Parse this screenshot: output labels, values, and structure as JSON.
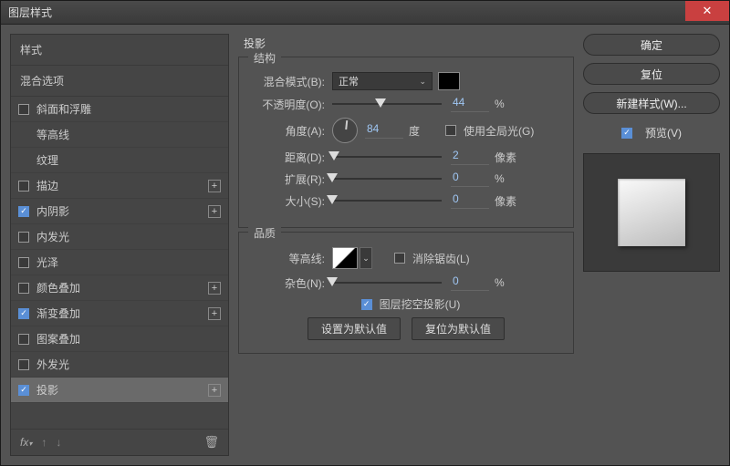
{
  "window": {
    "title": "图层样式"
  },
  "sidebar": {
    "header_styles": "样式",
    "header_blending": "混合选项",
    "items": [
      {
        "label": "斜面和浮雕",
        "checked": false
      },
      {
        "label": "等高线",
        "checked": false
      },
      {
        "label": "纹理",
        "checked": false
      },
      {
        "label": "描边",
        "checked": false,
        "plus": true
      },
      {
        "label": "内阴影",
        "checked": true,
        "plus": true
      },
      {
        "label": "内发光",
        "checked": false
      },
      {
        "label": "光泽",
        "checked": false
      },
      {
        "label": "颜色叠加",
        "checked": false,
        "plus": true
      },
      {
        "label": "渐变叠加",
        "checked": true,
        "plus": true
      },
      {
        "label": "图案叠加",
        "checked": false
      },
      {
        "label": "外发光",
        "checked": false
      },
      {
        "label": "投影",
        "checked": true,
        "plus": true,
        "selected": true
      }
    ]
  },
  "panel": {
    "title": "投影",
    "structure": {
      "label": "结构",
      "blend_mode_label": "混合模式(B):",
      "blend_mode_value": "正常",
      "shadow_color": "#000000",
      "opacity_label": "不透明度(O):",
      "opacity_value": "44",
      "angle_label": "角度(A):",
      "angle_value": "84",
      "global_light_label": "使用全局光(G)",
      "global_light_checked": false,
      "distance_label": "距离(D):",
      "distance_value": "2",
      "spread_label": "扩展(R):",
      "spread_value": "0",
      "size_label": "大小(S):",
      "size_value": "0"
    },
    "quality": {
      "label": "品质",
      "contour_label": "等高线:",
      "antialias_label": "消除锯齿(L)",
      "antialias_checked": false,
      "noise_label": "杂色(N):",
      "noise_value": "0",
      "knockout_label": "图层挖空投影(U)",
      "knockout_checked": true
    },
    "buttons": {
      "make_default": "设置为默认值",
      "reset_default": "复位为默认值"
    },
    "units": {
      "percent": "%",
      "degree": "度",
      "pixel": "像素"
    }
  },
  "actions": {
    "ok": "确定",
    "cancel": "复位",
    "new_style": "新建样式(W)...",
    "preview": "预览(V)",
    "preview_checked": true
  }
}
